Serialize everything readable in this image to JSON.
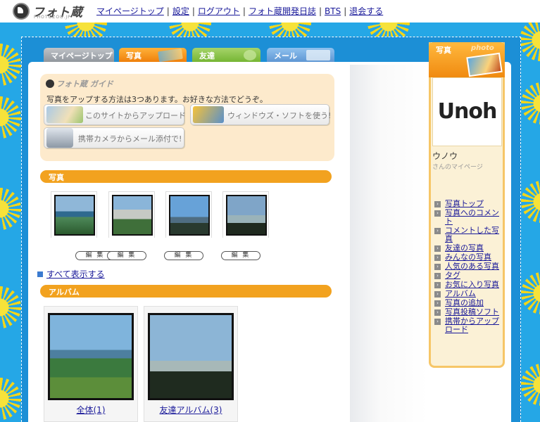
{
  "brand": {
    "name": "フォト蔵",
    "sub": "PHOTOZOU.JP"
  },
  "topnav": [
    "マイページトップ",
    "設定",
    "ログアウト",
    "フォト蔵開発日誌",
    "BTS",
    "退会する"
  ],
  "tabs": {
    "mypage": "マイページトップ",
    "photo": "写真",
    "friends": "友達",
    "mail": "メール"
  },
  "guide": {
    "title": "フォト蔵 ガイド",
    "intro": "写真をアップする方法は3つあります。お好きな方法でどうぞ。",
    "buttons": {
      "site": "このサイトからアップロード",
      "soft": "ウィンドウズ・ソフトを使う!",
      "mail": "携帯カメラからメール添付で!"
    }
  },
  "sections": {
    "photos": "写真",
    "albums": "アルバム"
  },
  "edit_label": "編 集",
  "show_all": "すべて表示する",
  "albums": [
    "全体(1)",
    "友達アルバム(3)"
  ],
  "sidebar": {
    "header": "写真",
    "header_deco": "photo",
    "avatar_text": "Unoh",
    "name": "ウノウ",
    "sub": "さんのマイページ",
    "menu": [
      "写真トップ",
      "写真へのコメント",
      "コメントした写真",
      "友達の写真",
      "みんなの写真",
      "人気のある写真",
      "タグ",
      "お気に入り写真",
      "アルバム",
      "写真の追加",
      "写真投稿ソフト",
      "携帯からアップロード"
    ]
  },
  "colors": {
    "sky": "#25a7e6",
    "orange": "#f2a21f",
    "link": "#1a1a9a"
  }
}
